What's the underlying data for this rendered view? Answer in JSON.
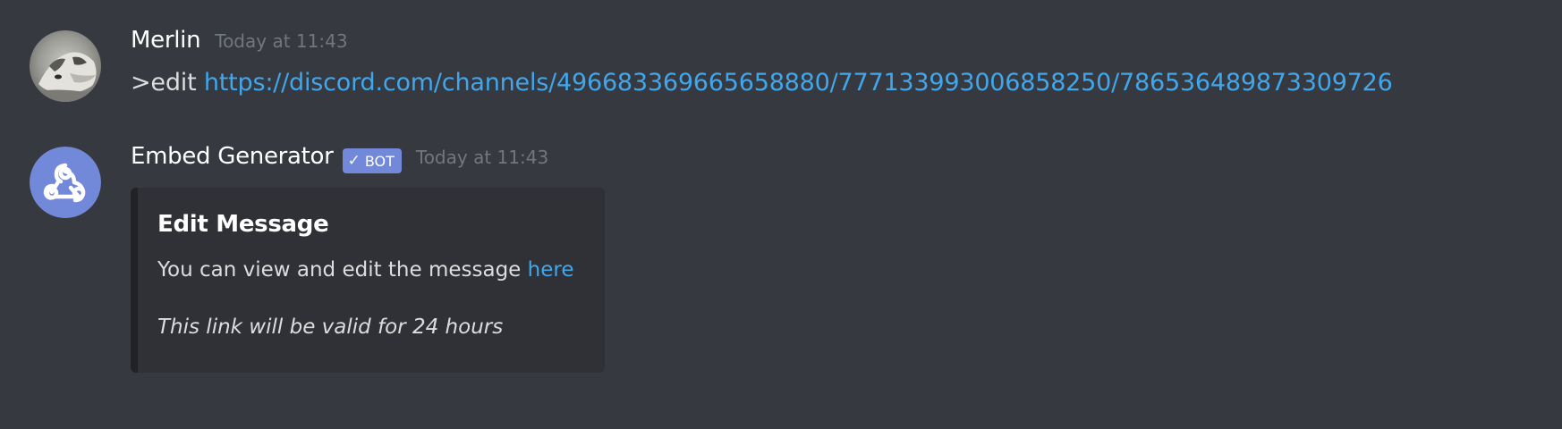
{
  "messages": [
    {
      "author": "Merlin",
      "timestamp": "Today at 11:43",
      "avatar_icon": "wolf-avatar-icon",
      "command": ">edit ",
      "link": "https://discord.com/channels/496683369665658880/777133993006858250/786536489873309726"
    },
    {
      "author": "Embed Generator",
      "bot_tag": "BOT",
      "bot_check": "✓",
      "timestamp": "Today at 11:43",
      "avatar_icon": "webhook-icon",
      "embed": {
        "title": "Edit Message",
        "description": "You can view and edit the message ",
        "description_link": "here",
        "note": "This link will be valid for 24 hours"
      }
    }
  ],
  "colors": {
    "background": "#36393f",
    "embed_background": "#2f3136",
    "bot_tag": "#7289da",
    "link": "#41a7ec",
    "username": "#ffffff",
    "timestamp": "#72767d",
    "text": "#dcddde"
  }
}
